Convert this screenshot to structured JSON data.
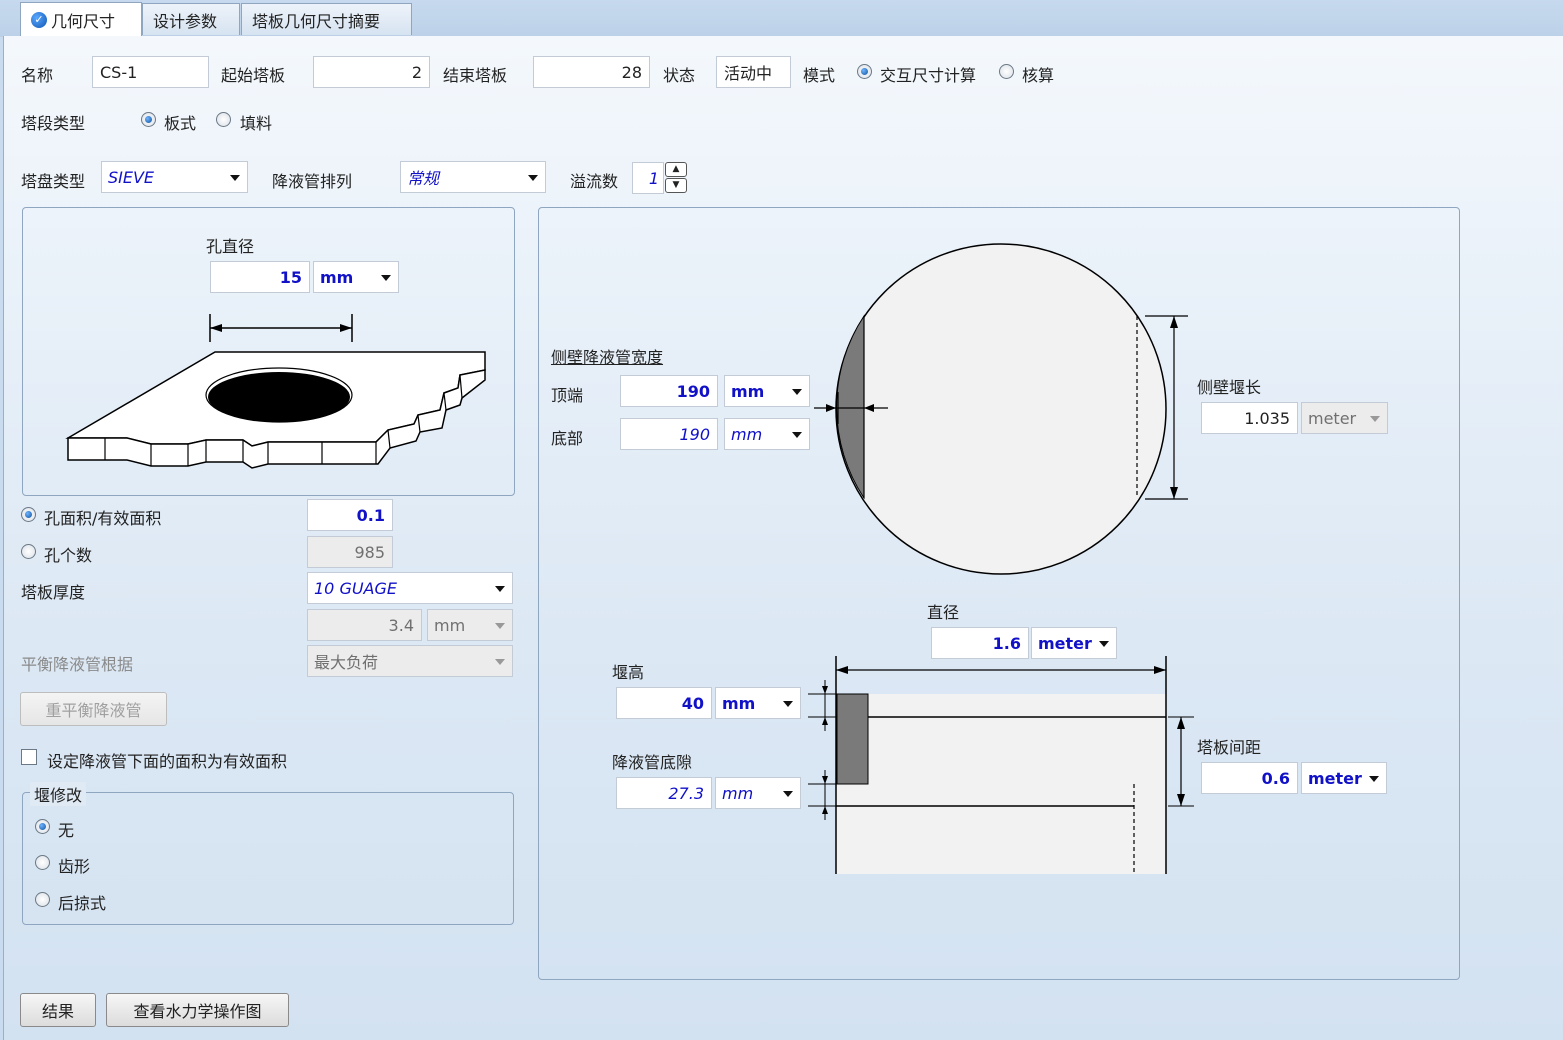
{
  "tabs": [
    {
      "label": "几何尺寸"
    },
    {
      "label": "设计参数"
    },
    {
      "label": "塔板几何尺寸摘要"
    }
  ],
  "header": {
    "name_label": "名称",
    "name_value": "CS-1",
    "start_label": "起始塔板",
    "start_value": "2",
    "end_label": "结束塔板",
    "end_value": "28",
    "status_label": "状态",
    "status_value": "活动中",
    "mode_label": "模式",
    "mode_opt1": "交互尺寸计算",
    "mode_opt2": "核算",
    "section_type_label": "塔段类型",
    "section_opt1": "板式",
    "section_opt2": "填料",
    "tray_type_label": "塔盘类型",
    "tray_type_value": "SIEVE",
    "dc_arrangement_label": "降液管排列",
    "dc_arrangement_value": "常规",
    "passes_label": "溢流数",
    "passes_value": "1"
  },
  "hole_panel": {
    "hole_dia_label": "孔直径",
    "hole_dia_value": "15",
    "hole_dia_unit": "mm"
  },
  "left": {
    "hole_area_label": "孔面积/有效面积",
    "hole_area_value": "0.1",
    "hole_count_label": "孔个数",
    "hole_count_value": "985",
    "thickness_label": "塔板厚度",
    "thickness_value": "10 GUAGE",
    "thickness_num": "3.4",
    "thickness_unit": "mm",
    "balance_label": "平衡降液管根据",
    "balance_value": "最大负荷",
    "rebalance_button": "重平衡降液管",
    "checkbox_label": "设定降液管下面的面积为有效面积",
    "weir_group_label": "堰修改",
    "weir_opt1": "无",
    "weir_opt2": "齿形",
    "weir_opt3": "后掠式"
  },
  "right": {
    "side_dc_width_label": "侧壁降液管宽度",
    "top_label": "顶端",
    "top_value": "190",
    "top_unit": "mm",
    "bottom_label": "底部",
    "bottom_value": "190",
    "bottom_unit": "mm",
    "side_weir_len_label": "侧壁堰长",
    "side_weir_len_value": "1.035",
    "side_weir_len_unit": "meter",
    "diameter_label": "直径",
    "diameter_value": "1.6",
    "diameter_unit": "meter",
    "weir_height_label": "堰高",
    "weir_height_value": "40",
    "weir_height_unit": "mm",
    "dc_clearance_label": "降液管底隙",
    "dc_clearance_value": "27.3",
    "dc_clearance_unit": "mm",
    "tray_spacing_label": "塔板间距",
    "tray_spacing_value": "0.6",
    "tray_spacing_unit": "meter"
  },
  "buttons": {
    "results": "结果",
    "hydraulic_plot": "查看水力学操作图"
  }
}
